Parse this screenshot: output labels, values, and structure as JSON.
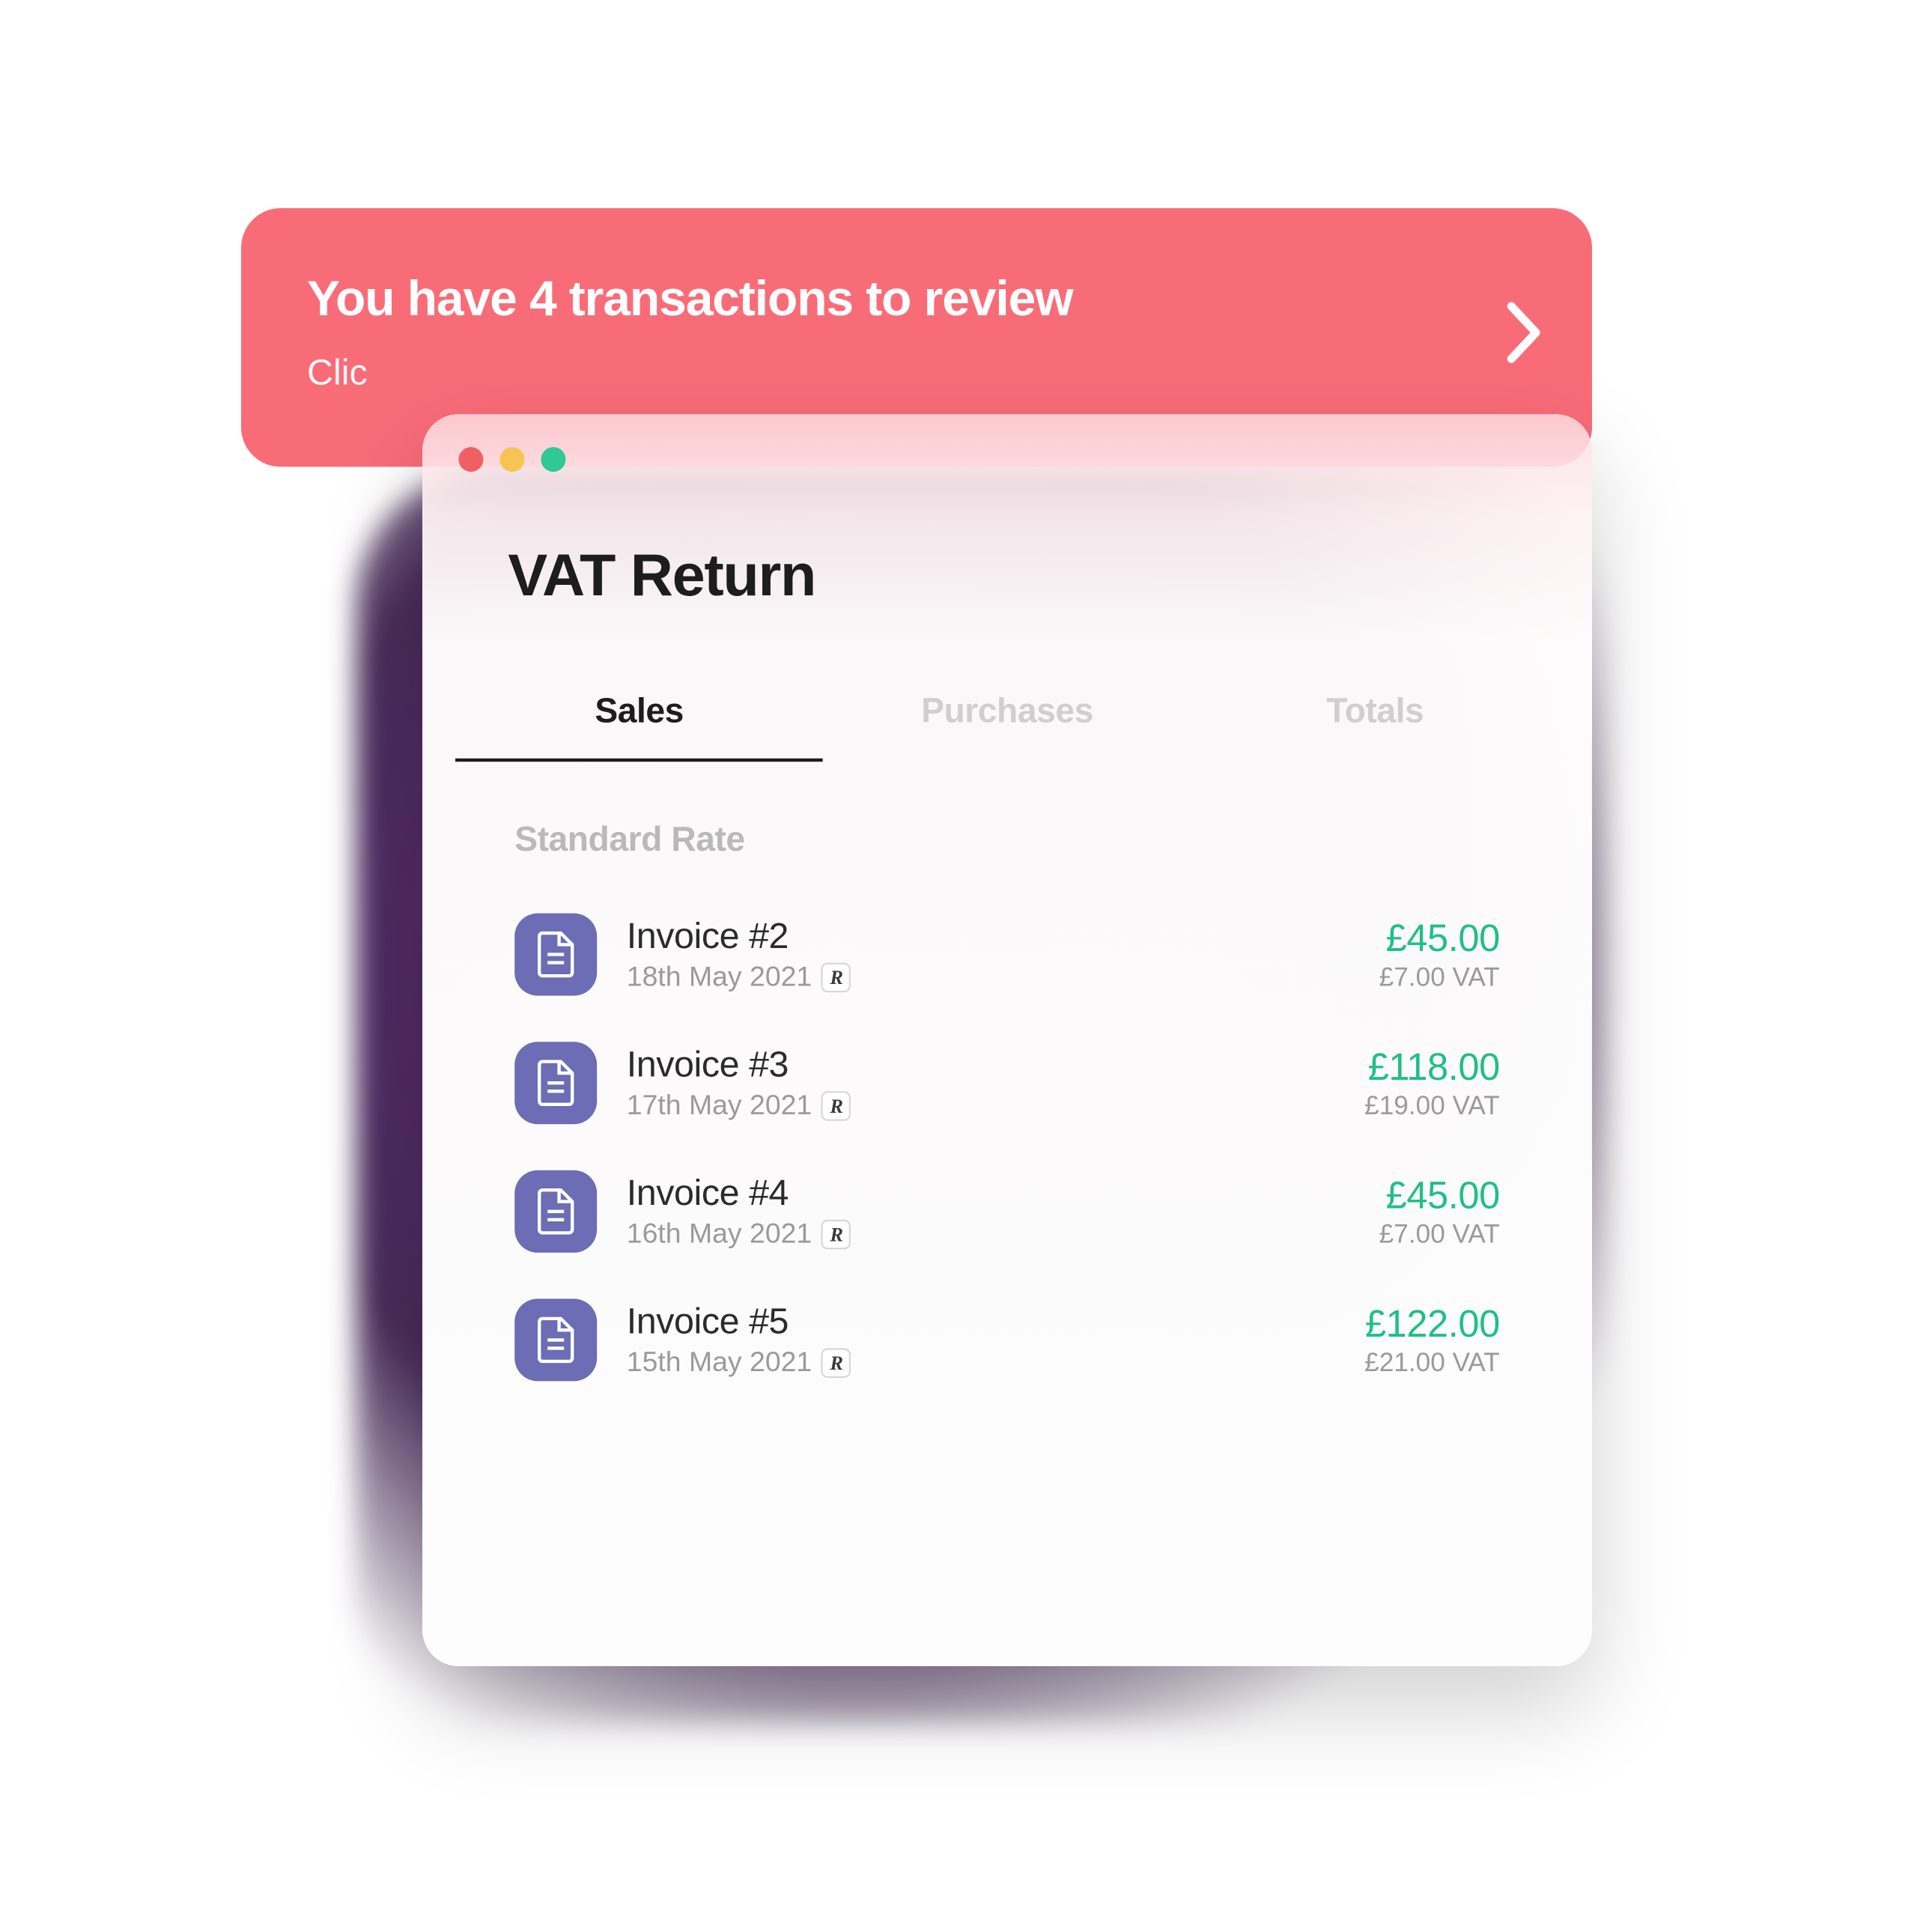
{
  "banner": {
    "title": "You have 4 transactions to review",
    "subtitle_visible": "Clic"
  },
  "window": {
    "title": "VAT Return",
    "tabs": [
      {
        "label": "Sales",
        "active": true
      },
      {
        "label": "Purchases",
        "active": false
      },
      {
        "label": "Totals",
        "active": false
      }
    ],
    "section_label": "Standard Rate",
    "items": [
      {
        "title": "Invoice #2",
        "date": "18th May 2021",
        "provider": "R",
        "amount": "£45.00",
        "vat": "£7.00 VAT"
      },
      {
        "title": "Invoice #3",
        "date": "17th May 2021",
        "provider": "R",
        "amount": "£118.00",
        "vat": "£19.00 VAT"
      },
      {
        "title": "Invoice #4",
        "date": "16th May 2021",
        "provider": "R",
        "amount": "£45.00",
        "vat": "£7.00 VAT"
      },
      {
        "title": "Invoice #5",
        "date": "15th May 2021",
        "provider": "R",
        "amount": "£122.00",
        "vat": "£21.00 VAT"
      }
    ]
  }
}
